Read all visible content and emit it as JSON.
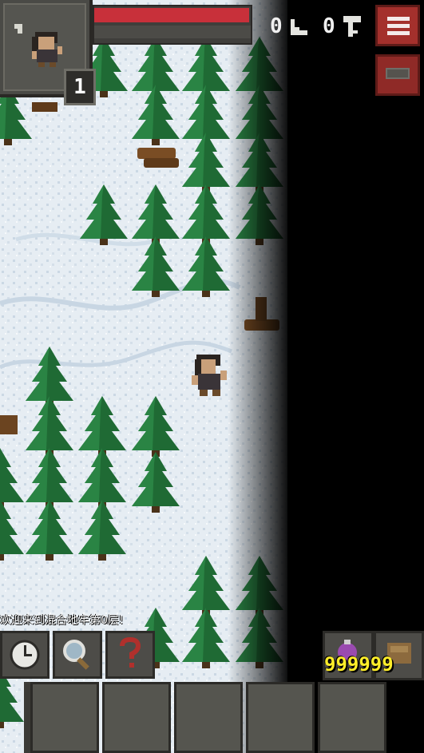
{
  "hud": {
    "hero_level": "1",
    "hp_fraction": 0.99,
    "depth_counter": "0",
    "keys_counter": "0",
    "gold": "999999"
  },
  "log": {
    "message": "欢迎来到混合地牢第0层!"
  },
  "toolbar": {
    "wait_icon": "clock-icon",
    "search_icon": "magnifier-icon",
    "info_icon": "question-mark-icon"
  },
  "quickslots": [
    "",
    "",
    "",
    "",
    ""
  ],
  "colors": {
    "snow": "#e8eef3",
    "tree": "#1e6b35",
    "hp": "#c8303a",
    "menu": "#a4302c",
    "gold_text": "#ffee2a"
  }
}
